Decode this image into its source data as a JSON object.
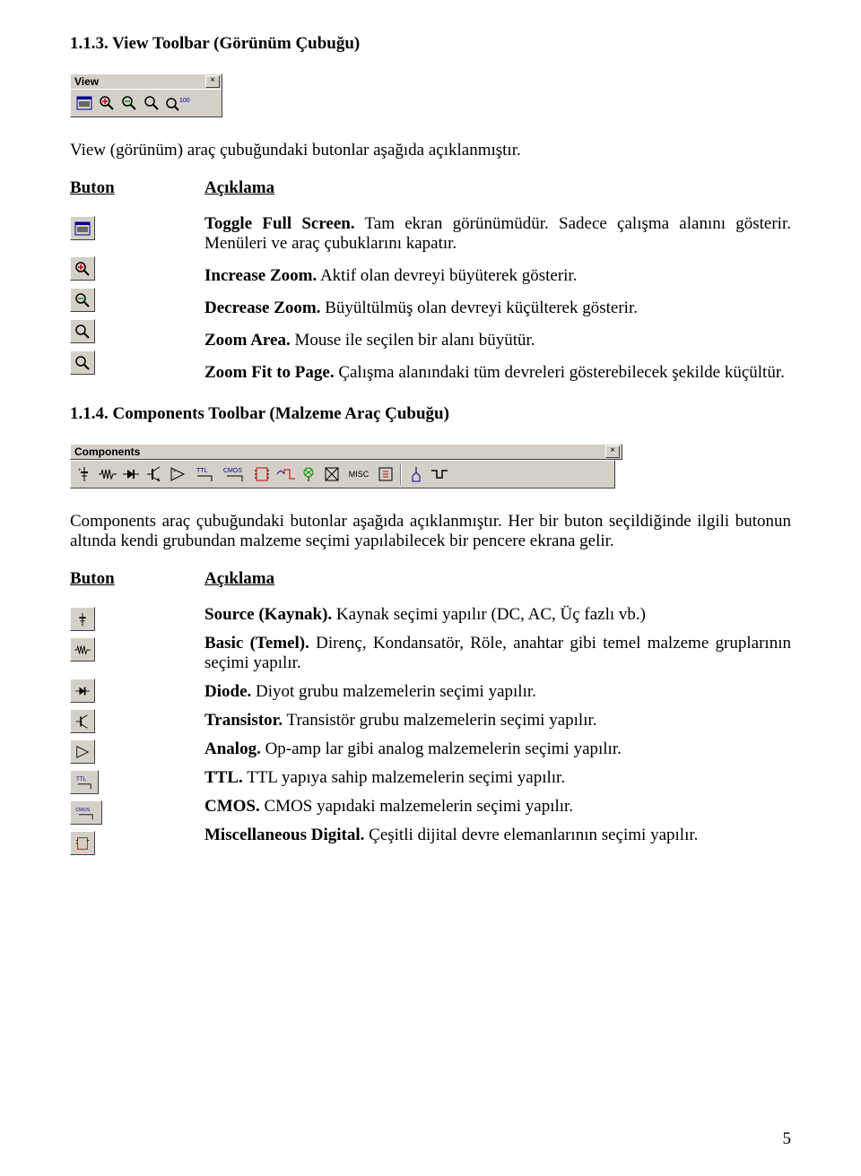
{
  "section1": {
    "heading": "1.1.3. View Toolbar (Görünüm Çubuğu)",
    "toolbar_title": "View",
    "intro": "View (görünüm) araç çubuğundaki butonlar aşağıda açıklanmıştır.",
    "col_button": "Buton",
    "col_desc": "Açıklama",
    "items": [
      {
        "term": "Toggle Full Screen.",
        "text": " Tam ekran görünümüdür. Sadece çalışma alanını gösterir. Menüleri ve araç çubuklarını kapatır."
      },
      {
        "term": "Increase Zoom.",
        "text": " Aktif olan devreyi büyüterek gösterir."
      },
      {
        "term": "Decrease Zoom.",
        "text": " Büyültülmüş olan devreyi küçülterek gösterir."
      },
      {
        "term": "Zoom Area.",
        "text": " Mouse ile seçilen bir alanı büyütür."
      },
      {
        "term": "Zoom Fit to Page.",
        "text": " Çalışma alanındaki tüm devreleri gösterebilecek şekilde küçültür."
      }
    ]
  },
  "section2": {
    "heading": "1.1.4. Components Toolbar (Malzeme Araç Çubuğu)",
    "toolbar_title": "Components",
    "intro": "Components araç çubuğundaki butonlar aşağıda açıklanmıştır. Her bir buton seçildiğinde ilgili butonun altında kendi grubundan malzeme seçimi yapılabilecek bir pencere ekrana gelir.",
    "col_button": "Buton",
    "col_desc": "Açıklama",
    "items": [
      {
        "term": "Source (Kaynak).",
        "text": " Kaynak seçimi yapılır (DC, AC, Üç fazlı vb.)"
      },
      {
        "term": "Basic (Temel).",
        "text": " Direnç, Kondansatör, Röle, anahtar gibi temel malzeme gruplarının seçimi yapılır."
      },
      {
        "term": "Diode.",
        "text": " Diyot grubu malzemelerin seçimi yapılır."
      },
      {
        "term": "Transistor.",
        "text": " Transistör grubu malzemelerin seçimi yapılır."
      },
      {
        "term": "Analog.",
        "text": " Op-amp lar gibi analog malzemelerin seçimi yapılır."
      },
      {
        "term": "TTL.",
        "text": " TTL yapıya sahip malzemelerin seçimi yapılır."
      },
      {
        "term": "CMOS.",
        "text": " CMOS yapıdaki malzemelerin seçimi yapılır."
      },
      {
        "term": "Miscellaneous Digital.",
        "text": " Çeşitli dijital devre elemanlarının seçimi yapılır."
      }
    ]
  },
  "page_number": "5"
}
